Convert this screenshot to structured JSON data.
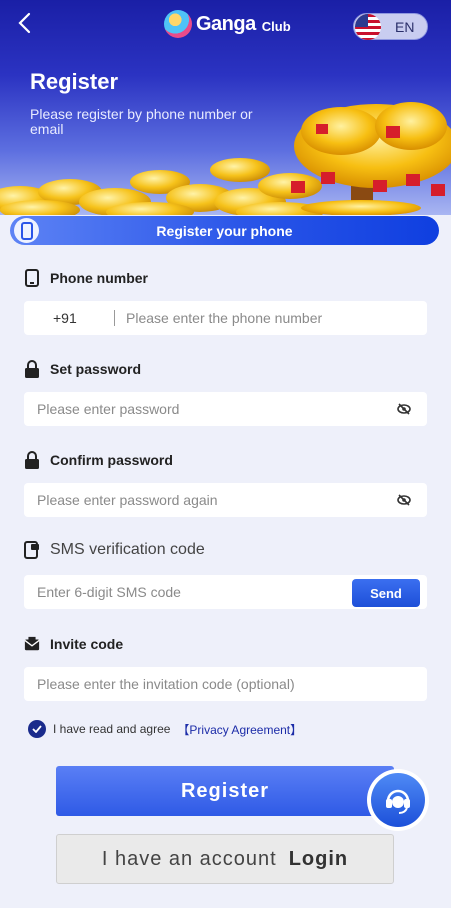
{
  "header": {
    "back_icon": "chevron-left-icon",
    "logo_text": "Ganga",
    "logo_sub": "Club",
    "language": "EN",
    "flag_icon": "us-flag-icon"
  },
  "hero": {
    "title": "Register",
    "subtitle": "Please register by phone number or email"
  },
  "tab": {
    "label": "Register your phone",
    "icon": "phone-icon"
  },
  "phone": {
    "label": "Phone number",
    "country_code": "+91",
    "placeholder": "Please enter the phone number",
    "icon": "phone-icon"
  },
  "password": {
    "label": "Set password",
    "placeholder": "Please enter password",
    "icon": "lock-icon"
  },
  "confirm": {
    "label": "Confirm password",
    "placeholder": "Please enter password again",
    "icon": "lock-icon"
  },
  "sms": {
    "label": "SMS verification code",
    "placeholder": "Enter 6-digit SMS code",
    "send_label": "Send",
    "icon": "sms-phone-icon"
  },
  "invite": {
    "label": "Invite code",
    "placeholder": "Please enter the invitation code (optional)",
    "icon": "envelope-icon"
  },
  "agreement": {
    "text": "I have read and agree",
    "link": "【Privacy Agreement】"
  },
  "actions": {
    "register": "Register",
    "have_account": "I have an account",
    "login": "Login"
  },
  "colors": {
    "primary": "#2f5ae6",
    "header": "#1a1fa6",
    "checkbox": "#1a2b8c"
  }
}
